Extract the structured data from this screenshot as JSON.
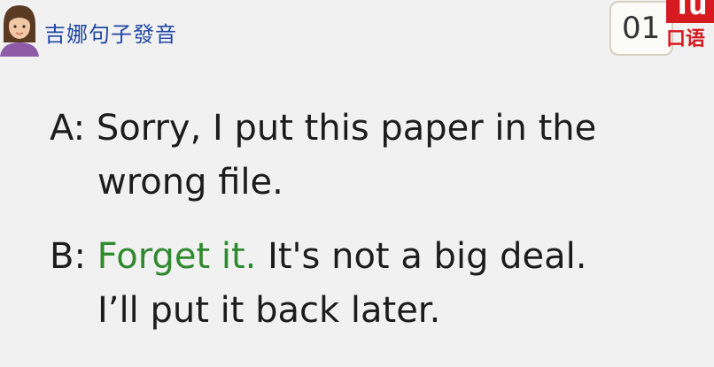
{
  "header": {
    "brand_title": "吉娜句子發音",
    "avatar_icon": "person-avatar-icon"
  },
  "badge": {
    "lesson_number": "01",
    "logo_red_text": "Tu",
    "logo_sub_text": "口语"
  },
  "colors": {
    "background": "#f1f1f1",
    "brand_blue": "#1f47a3",
    "highlight_green": "#2f8a2f",
    "logo_red": "#d71920",
    "text_dark": "#1c1c1c"
  },
  "dialogue": {
    "a": {
      "speaker": "A:",
      "line1": "Sorry, I put this paper in the",
      "line2": "wrong file."
    },
    "b": {
      "speaker": "B:",
      "highlight": "Forget it.",
      "line1_rest": "It's not a big deal.",
      "line2": "I’ll put it back later."
    }
  }
}
